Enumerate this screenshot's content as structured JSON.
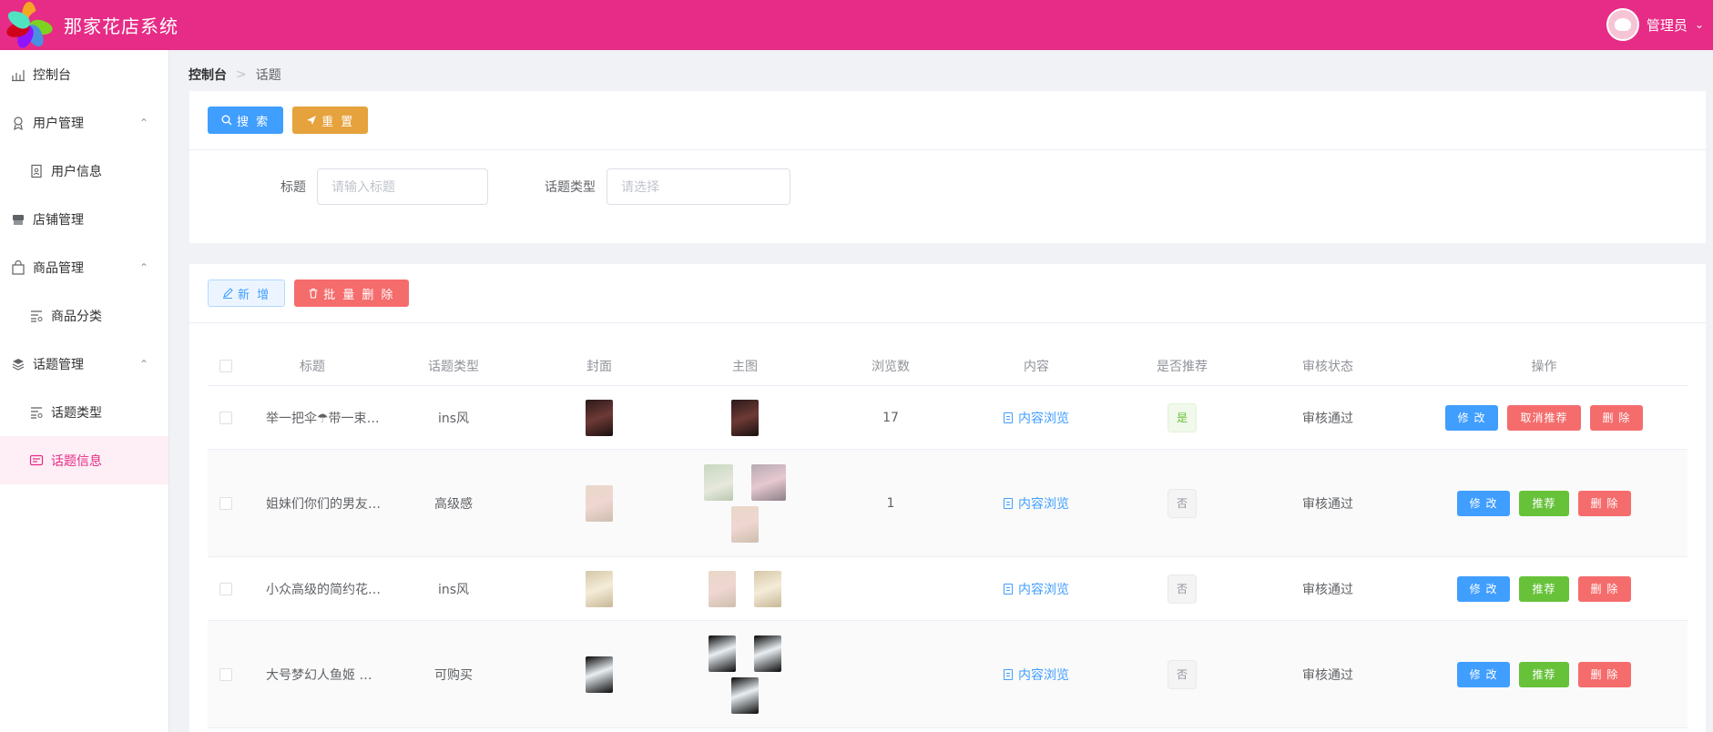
{
  "header": {
    "app_title": "那家花店系统",
    "user_name": "管理员"
  },
  "sidebar": {
    "items": [
      {
        "label": "控制台",
        "icon": "dashboard-icon"
      },
      {
        "label": "用户管理",
        "icon": "user-icon",
        "expanded": true
      },
      {
        "label": "用户信息",
        "icon": "user-card-icon",
        "sub": true
      },
      {
        "label": "店铺管理",
        "icon": "store-icon"
      },
      {
        "label": "商品管理",
        "icon": "bag-icon",
        "expanded": true
      },
      {
        "label": "商品分类",
        "icon": "list-icon",
        "sub": true
      },
      {
        "label": "话题管理",
        "icon": "layers-icon",
        "expanded": true
      },
      {
        "label": "话题类型",
        "icon": "list-icon",
        "sub": true
      },
      {
        "label": "话题信息",
        "icon": "message-icon",
        "sub": true,
        "active": true
      }
    ]
  },
  "breadcrumb": {
    "root": "控制台",
    "separator": ">",
    "current": "话题"
  },
  "search_panel": {
    "search_label": "搜 索",
    "reset_label": "重 置",
    "title_label": "标题",
    "title_placeholder": "请输入标题",
    "type_label": "话题类型",
    "type_placeholder": "请选择"
  },
  "actions": {
    "add_label": "新 增",
    "batch_delete_label": "批 量 删 除"
  },
  "table": {
    "columns": [
      "标题",
      "话题类型",
      "封面",
      "主图",
      "浏览数",
      "内容",
      "是否推荐",
      "审核状态",
      "操作"
    ],
    "rows": [
      {
        "title": "举一把伞☂带一束花...",
        "type": "ins风",
        "views": "17",
        "content": "内容浏览",
        "recommended": "是",
        "status": "审核通过",
        "ops": [
          "修 改",
          "取消推荐",
          "删 除"
        ]
      },
      {
        "title": "姐妹们你们的男友也...",
        "type": "高级感",
        "views": "1",
        "content": "内容浏览",
        "recommended": "否",
        "status": "审核通过",
        "ops": [
          "修 改",
          "推荐",
          "删 除"
        ]
      },
      {
        "title": "小众高级的简约花束...",
        "type": "ins风",
        "views": "",
        "content": "内容浏览",
        "recommended": "否",
        "status": "审核通过",
        "ops": [
          "修 改",
          "推荐",
          "删 除"
        ]
      },
      {
        "title": "大号梦幻人鱼姬 仙气...",
        "type": "可购买",
        "views": "",
        "content": "内容浏览",
        "recommended": "否",
        "status": "审核通过",
        "ops": [
          "修 改",
          "推荐",
          "删 除"
        ]
      }
    ]
  },
  "colors": {
    "brand": "#e62c86",
    "primary": "#409eff",
    "warning": "#e6a23c",
    "danger": "#f56c6c",
    "success": "#67c23a"
  }
}
